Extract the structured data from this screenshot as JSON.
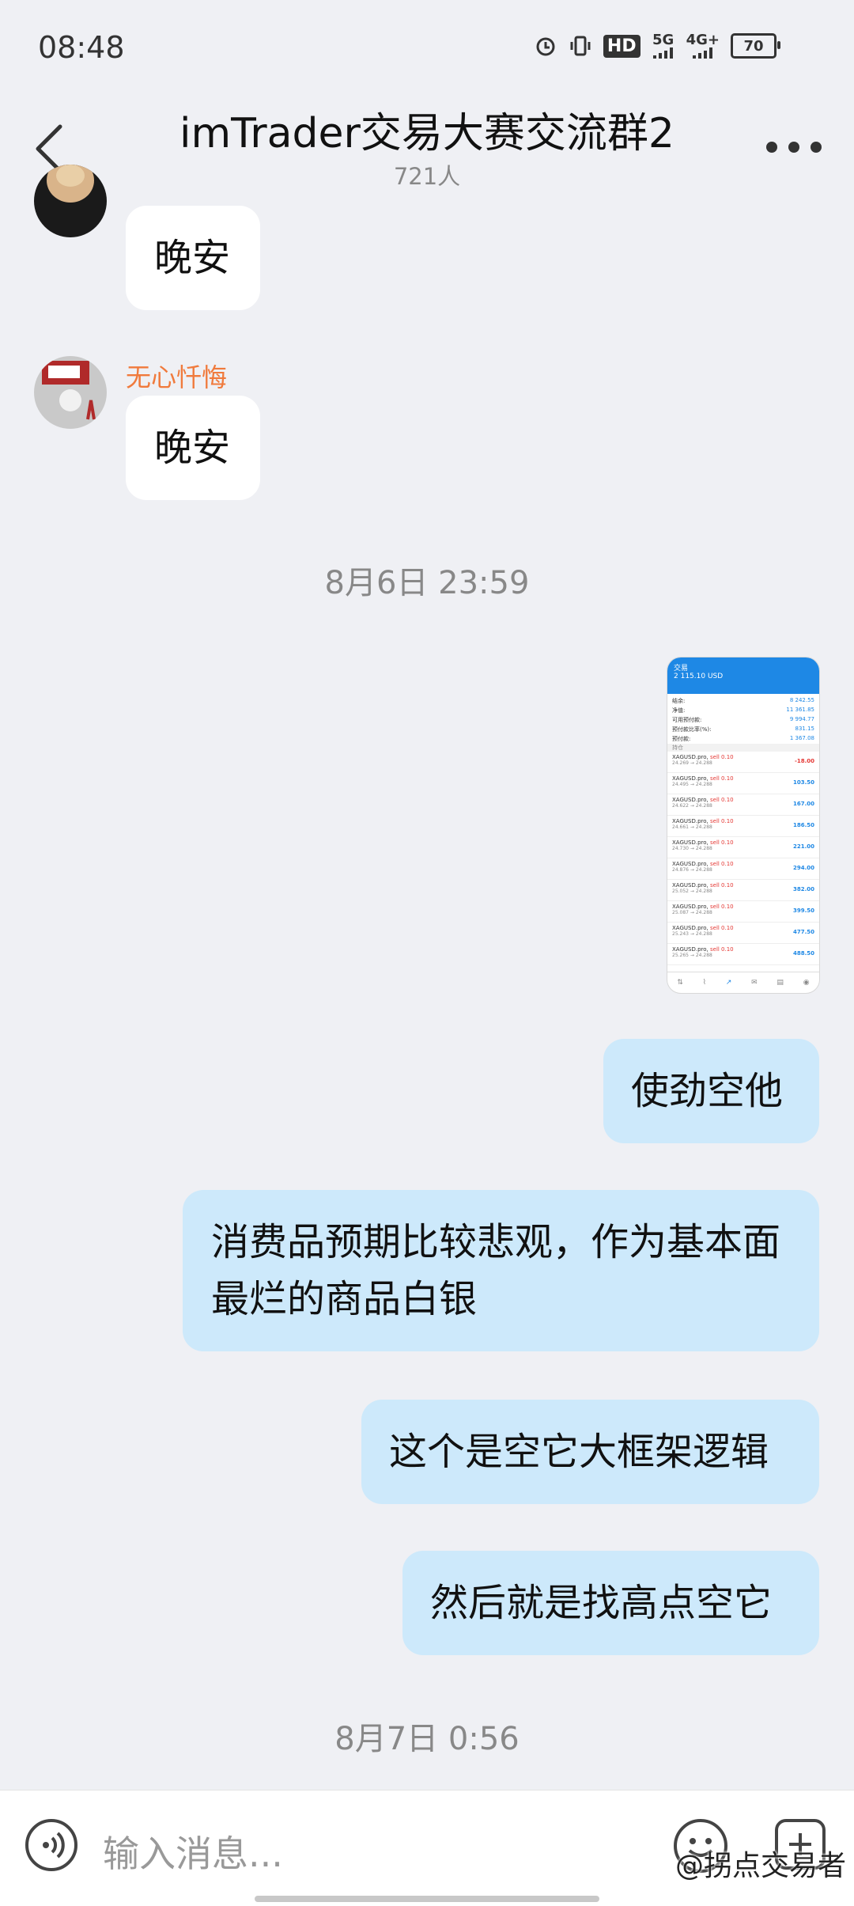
{
  "status": {
    "time": "08:48",
    "network_hd": "HD",
    "network_5g": "5G",
    "network_4g": "4G+",
    "battery": "70"
  },
  "header": {
    "title": "imTrader交易大赛交流群2",
    "member_count": "721人"
  },
  "messages": {
    "m1_text": "晚安",
    "m2_sender": "无心忏悔",
    "m2_text": "晚安",
    "ts1": "8月6日 23:59",
    "m4_text": "使劲空他",
    "m5_text": "消费品预期比较悲观，作为基本面最烂的商品白银",
    "m6_text": "这个是空它大框架逻辑",
    "m7_text": "然后就是找高点空它",
    "ts2": "8月7日 0:56"
  },
  "screenshot": {
    "header_label": "交易",
    "balance": "2 115.10 USD",
    "rows": [
      {
        "label": "结余:",
        "value": "8 242.55"
      },
      {
        "label": "净值:",
        "value": "11 361.85"
      },
      {
        "label": "可用预付款:",
        "value": "9 994.77"
      },
      {
        "label": "预付款比率(%):",
        "value": "831.15"
      },
      {
        "label": "预付款:",
        "value": "1 367.08"
      }
    ],
    "section": "持仓",
    "trades": [
      {
        "symbol": "XAGUSD.pro,",
        "side": "sell 0.10",
        "prices": "24.269 → 24.288",
        "pnl": "-18.00"
      },
      {
        "symbol": "XAGUSD.pro,",
        "side": "sell 0.10",
        "prices": "24.495 → 24.288",
        "pnl": "103.50"
      },
      {
        "symbol": "XAGUSD.pro,",
        "side": "sell 0.10",
        "prices": "24.622 → 24.288",
        "pnl": "167.00"
      },
      {
        "symbol": "XAGUSD.pro,",
        "side": "sell 0.10",
        "prices": "24.661 → 24.288",
        "pnl": "186.50"
      },
      {
        "symbol": "XAGUSD.pro,",
        "side": "sell 0.10",
        "prices": "24.730 → 24.288",
        "pnl": "221.00"
      },
      {
        "symbol": "XAGUSD.pro,",
        "side": "sell 0.10",
        "prices": "24.876 → 24.288",
        "pnl": "294.00"
      },
      {
        "symbol": "XAGUSD.pro,",
        "side": "sell 0.10",
        "prices": "25.052 → 24.288",
        "pnl": "382.00"
      },
      {
        "symbol": "XAGUSD.pro,",
        "side": "sell 0.10",
        "prices": "25.087 → 24.288",
        "pnl": "399.50"
      },
      {
        "symbol": "XAGUSD.pro,",
        "side": "sell 0.10",
        "prices": "25.243 → 24.288",
        "pnl": "477.50"
      },
      {
        "symbol": "XAGUSD.pro,",
        "side": "sell 0.10",
        "prices": "25.265 → 24.288",
        "pnl": "488.50"
      }
    ]
  },
  "input": {
    "placeholder": "输入消息...",
    "watermark": "@拐点交易者"
  }
}
